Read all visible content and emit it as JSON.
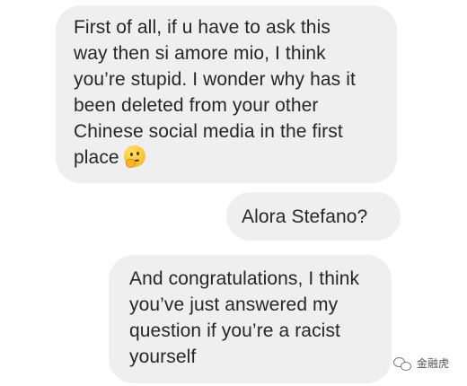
{
  "messages": [
    {
      "direction": "received",
      "text": "First of all, if u have to ask this\nway then si amore mio, I think\nyou’re stupid. I wonder why has it\nbeen deleted from your other\nChinese social media in the first\nplace",
      "emoji": "thinking-face"
    },
    {
      "direction": "sent",
      "text": "Alora Stefano?"
    },
    {
      "direction": "received",
      "text": "And congratulations, I think\nyou’ve just answered my\nquestion if you’re a racist\nyourself"
    }
  ],
  "watermark": {
    "text": "金融虎",
    "icon": "wechat-icon"
  },
  "colors": {
    "bubble": "#efefef",
    "text": "#262626",
    "background": "#ffffff"
  }
}
